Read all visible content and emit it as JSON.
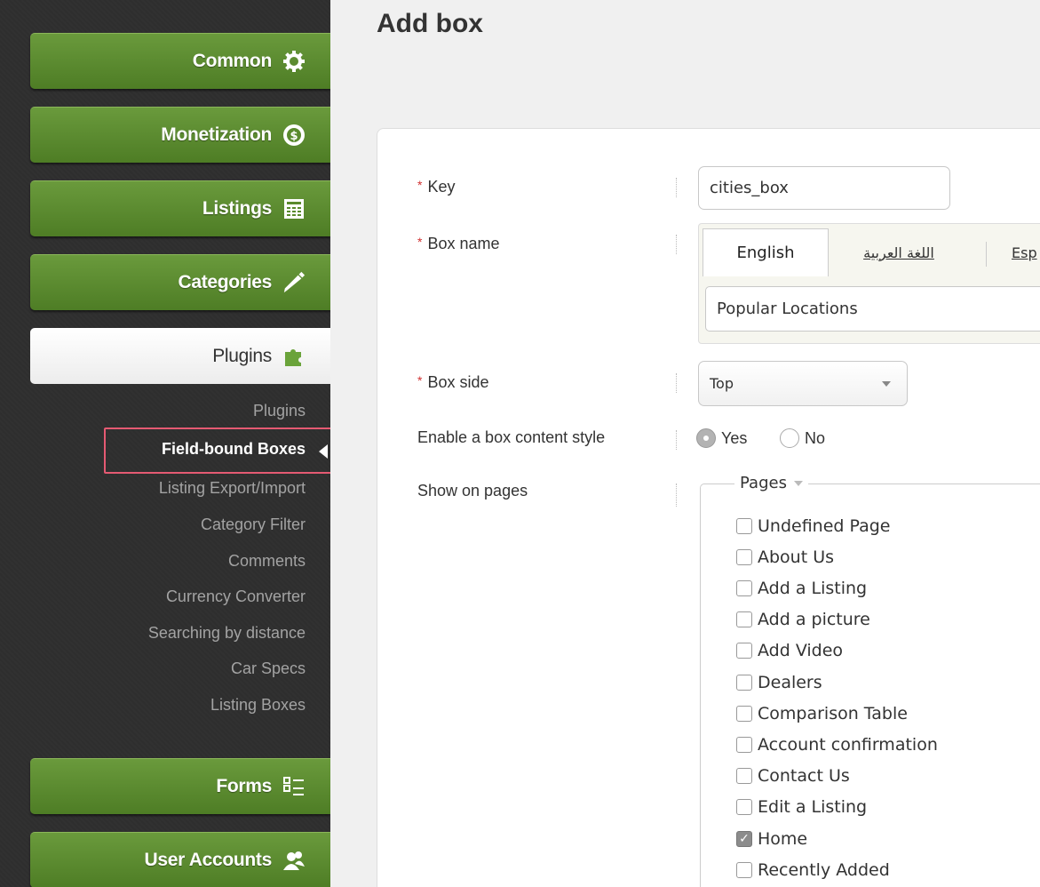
{
  "sidebar": {
    "nav": [
      {
        "label": "Common",
        "icon": "gear-icon"
      },
      {
        "label": "Monetization",
        "icon": "dollar-coin-icon"
      },
      {
        "label": "Listings",
        "icon": "listings-icon"
      },
      {
        "label": "Categories",
        "icon": "pencil-icon"
      },
      {
        "label": "Plugins",
        "icon": "puzzle-icon"
      },
      {
        "label": "Forms",
        "icon": "checklist-icon"
      },
      {
        "label": "User Accounts",
        "icon": "users-icon"
      }
    ],
    "plugin_items": [
      "Plugins",
      "Field-bound Boxes",
      "Listing Export/Import",
      "Category Filter",
      "Comments",
      "Currency Converter",
      "Searching by distance",
      "Car Specs",
      "Listing Boxes"
    ]
  },
  "main": {
    "title": "Add box",
    "fields": {
      "key_label": "Key",
      "key_value": "cities_box",
      "name_label": "Box name",
      "tabs": [
        "English",
        "اللغة العربية",
        "Esp"
      ],
      "name_value": "Popular Locations",
      "side_label": "Box side",
      "side_value": "Top",
      "style_label": "Enable a box content style",
      "style_yes": "Yes",
      "style_no": "No",
      "pages_label": "Show on pages",
      "pages_legend": "Pages",
      "required_mark": "*"
    },
    "pages": [
      {
        "label": "Undefined Page",
        "checked": false
      },
      {
        "label": "About Us",
        "checked": false
      },
      {
        "label": "Add a Listing",
        "checked": false
      },
      {
        "label": "Add a picture",
        "checked": false
      },
      {
        "label": "Add Video",
        "checked": false
      },
      {
        "label": "Dealers",
        "checked": false
      },
      {
        "label": "Comparison Table",
        "checked": false
      },
      {
        "label": "Account confirmation",
        "checked": false
      },
      {
        "label": "Contact Us",
        "checked": false
      },
      {
        "label": "Edit a Listing",
        "checked": false
      },
      {
        "label": "Home",
        "checked": true
      },
      {
        "label": "Recently Added",
        "checked": false
      }
    ]
  }
}
